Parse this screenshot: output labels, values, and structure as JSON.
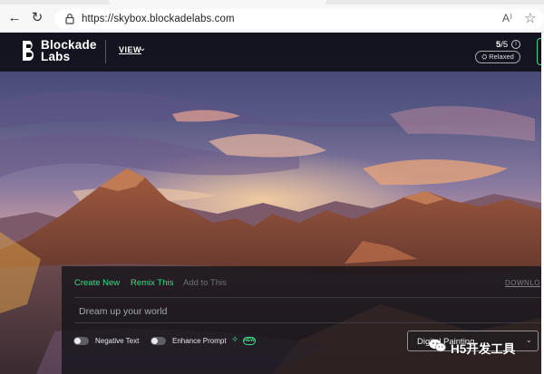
{
  "browser": {
    "back_glyph": "←",
    "refresh_glyph": "↻",
    "url": "https://skybox.blockadelabs.com",
    "read_aloud_glyph": "A⁾",
    "favorite_glyph": "☆",
    "icons": [
      "back-arrow-icon",
      "refresh-icon",
      "lock-icon",
      "read-aloud-icon",
      "favorite-star-icon"
    ]
  },
  "header": {
    "logo_line1": "Blockade",
    "logo_line2": "Labs",
    "view_label": "VIEW",
    "view_chevron": "⌄",
    "credits_used": "5",
    "credits_total": "/5",
    "info_glyph": "i",
    "mode_badge": "⛭ Relaxed"
  },
  "panel": {
    "tabs": [
      {
        "label": "Create New",
        "active": true
      },
      {
        "label": "Remix This",
        "active": true
      },
      {
        "label": "Add to This",
        "active": false
      }
    ],
    "download_label": "DOWNLO",
    "prompt_placeholder": "Dream up your world",
    "prompt_value": "",
    "toggles": [
      {
        "label": "Negative Text",
        "on": false
      },
      {
        "label": "Enhance Prompt",
        "on": false
      }
    ],
    "sparkle_glyph": "✧",
    "new_badge": "NEW",
    "style_select": {
      "value": "Digital Painting",
      "chevron": "⌄"
    }
  },
  "watermark": {
    "text": "H5开发工具"
  },
  "colors": {
    "accent": "#3ddc84",
    "topbar_bg": "#0e0e14",
    "panel_bg": "#121218",
    "sky_top": "#3a3e68",
    "sky_glow": "#f0a070",
    "mountain": "#7a4030"
  }
}
